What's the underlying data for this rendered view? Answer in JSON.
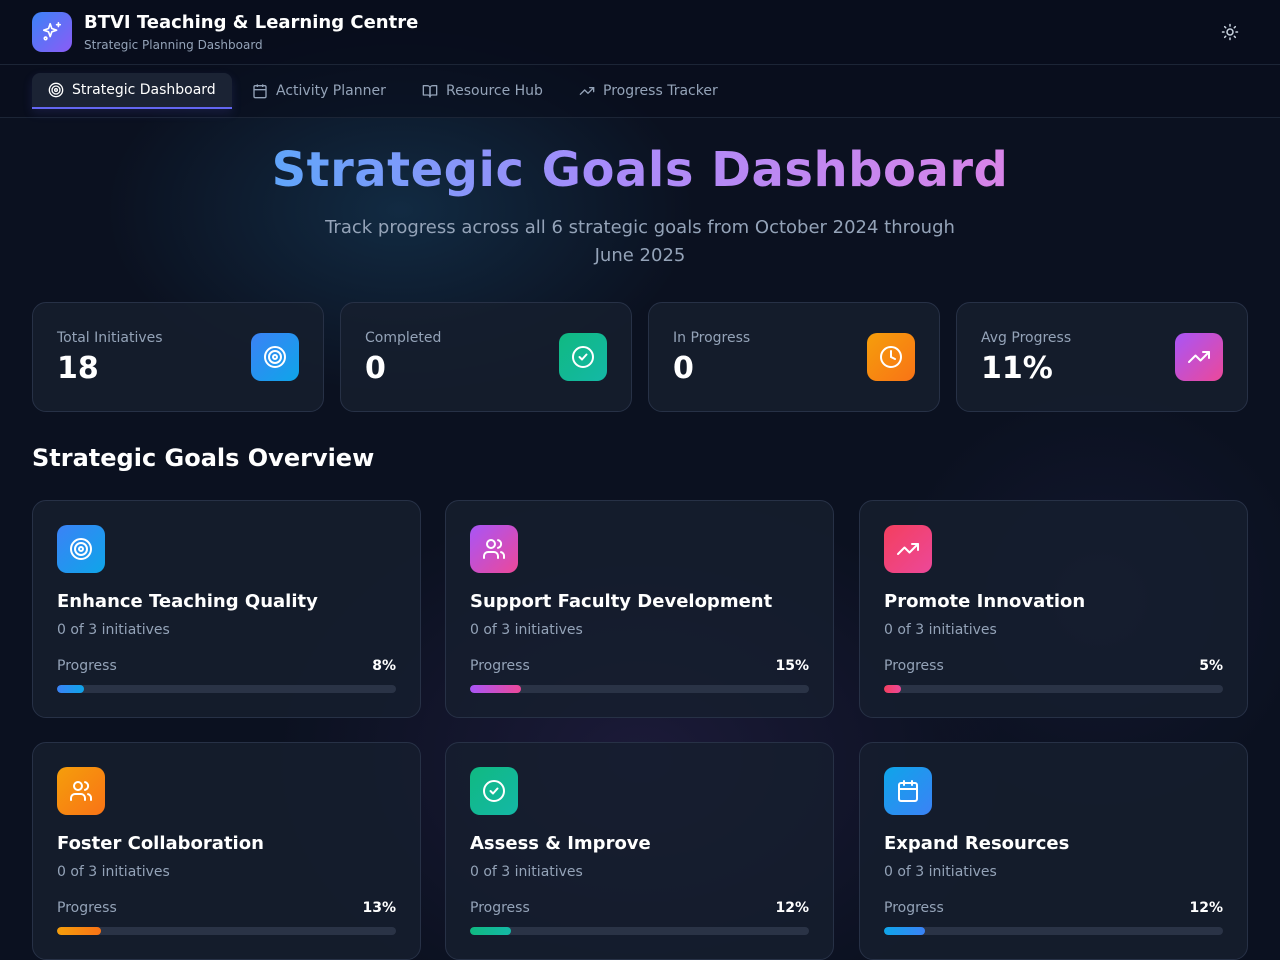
{
  "app": {
    "title": "BTVI Teaching & Learning Centre",
    "subtitle": "Strategic Planning Dashboard",
    "logo_icon": "sparkles-icon",
    "theme_icon": "sun-icon"
  },
  "tabs": [
    {
      "label": "Strategic Dashboard",
      "icon": "target-icon",
      "active": true
    },
    {
      "label": "Activity Planner",
      "icon": "calendar-icon",
      "active": false
    },
    {
      "label": "Resource Hub",
      "icon": "book-open-icon",
      "active": false
    },
    {
      "label": "Progress Tracker",
      "icon": "trending-up-icon",
      "active": false
    }
  ],
  "hero": {
    "title": "Strategic Goals Dashboard",
    "subtitle": "Track progress across all 6 strategic goals from October 2024 through June 2025"
  },
  "stats": [
    {
      "label": "Total Initiatives",
      "value": "18",
      "icon": "target-icon",
      "color": "#3b82f6"
    },
    {
      "label": "Completed",
      "value": "0",
      "icon": "check-circle-icon",
      "color": "#10b981"
    },
    {
      "label": "In Progress",
      "value": "0",
      "icon": "clock-icon",
      "color": "#f59e0b"
    },
    {
      "label": "Avg Progress",
      "value": "11%",
      "icon": "trending-up-icon",
      "color": "#d946ef"
    }
  ],
  "overview": {
    "title": "Strategic Goals Overview",
    "progress_label": "Progress",
    "goals": [
      {
        "title": "Enhance Teaching Quality",
        "count": "0 of 3 initiatives",
        "progress": 8,
        "progress_text": "8%",
        "icon": "target-icon",
        "color": "#3b82f6"
      },
      {
        "title": "Support Faculty Development",
        "count": "0 of 3 initiatives",
        "progress": 15,
        "progress_text": "15%",
        "icon": "users-icon",
        "color": "#d946ef"
      },
      {
        "title": "Promote Innovation",
        "count": "0 of 3 initiatives",
        "progress": 5,
        "progress_text": "5%",
        "icon": "trending-up-icon",
        "color": "#f43f5e"
      },
      {
        "title": "Foster Collaboration",
        "count": "0 of 3 initiatives",
        "progress": 13,
        "progress_text": "13%",
        "icon": "users-icon",
        "color": "#f59e0b"
      },
      {
        "title": "Assess & Improve",
        "count": "0 of 3 initiatives",
        "progress": 12,
        "progress_text": "12%",
        "icon": "check-circle-icon",
        "color": "#10b981"
      },
      {
        "title": "Expand Resources",
        "count": "0 of 3 initiatives",
        "progress": 12,
        "progress_text": "12%",
        "icon": "calendar-icon",
        "color": "#0ea5e9"
      }
    ]
  }
}
